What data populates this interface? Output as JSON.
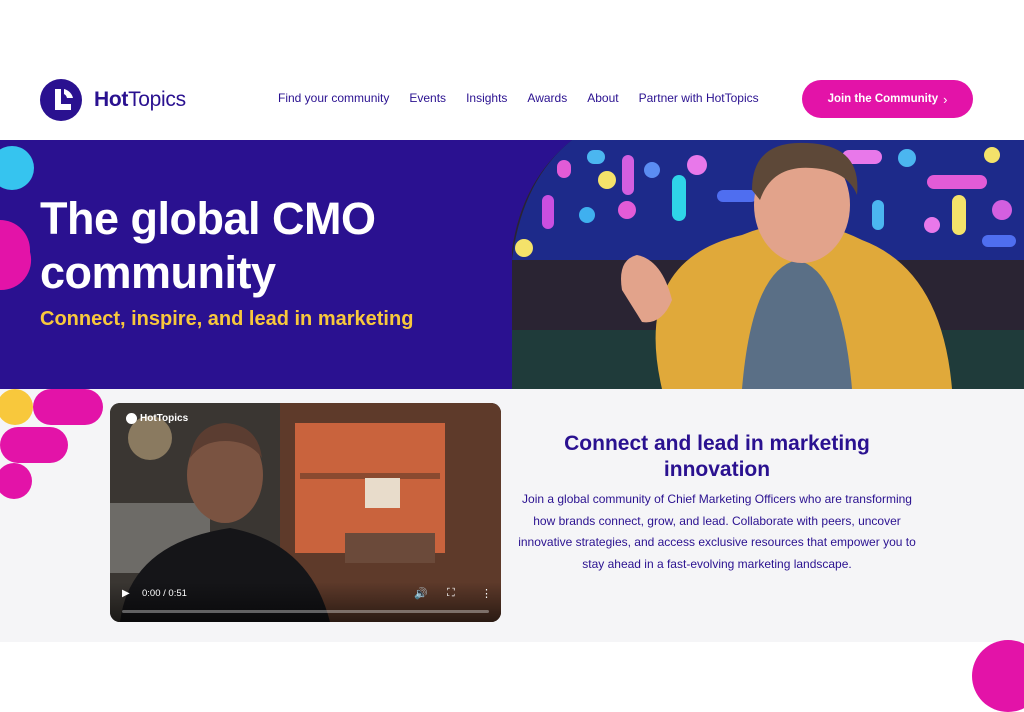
{
  "brand": {
    "name_bold": "Hot",
    "name_rest": "Topics"
  },
  "nav": {
    "items": [
      "Find your community",
      "Events",
      "Insights",
      "Awards",
      "About",
      "Partner with HotTopics"
    ],
    "cta_label": "Join the Community"
  },
  "hero": {
    "title_line1": "The global CMO",
    "title_line2": "community",
    "subtitle": "Connect, inspire, and lead in marketing"
  },
  "video": {
    "brand_label": "HotTopics",
    "current_time": "0:00",
    "duration": "0:51",
    "progress": 0
  },
  "intro": {
    "heading": "Connect and lead in marketing innovation",
    "body": "Join a global community of Chief Marketing Officers who are transforming how brands connect, grow, and lead. Collaborate with peers, uncover innovative strategies, and access exclusive resources that empower you to stay ahead in a fast-evolving marketing landscape."
  },
  "colors": {
    "brand_purple": "#2a1190",
    "accent_pink": "#e313a8",
    "accent_yellow": "#f8c83c",
    "accent_cyan": "#36c4ef"
  }
}
